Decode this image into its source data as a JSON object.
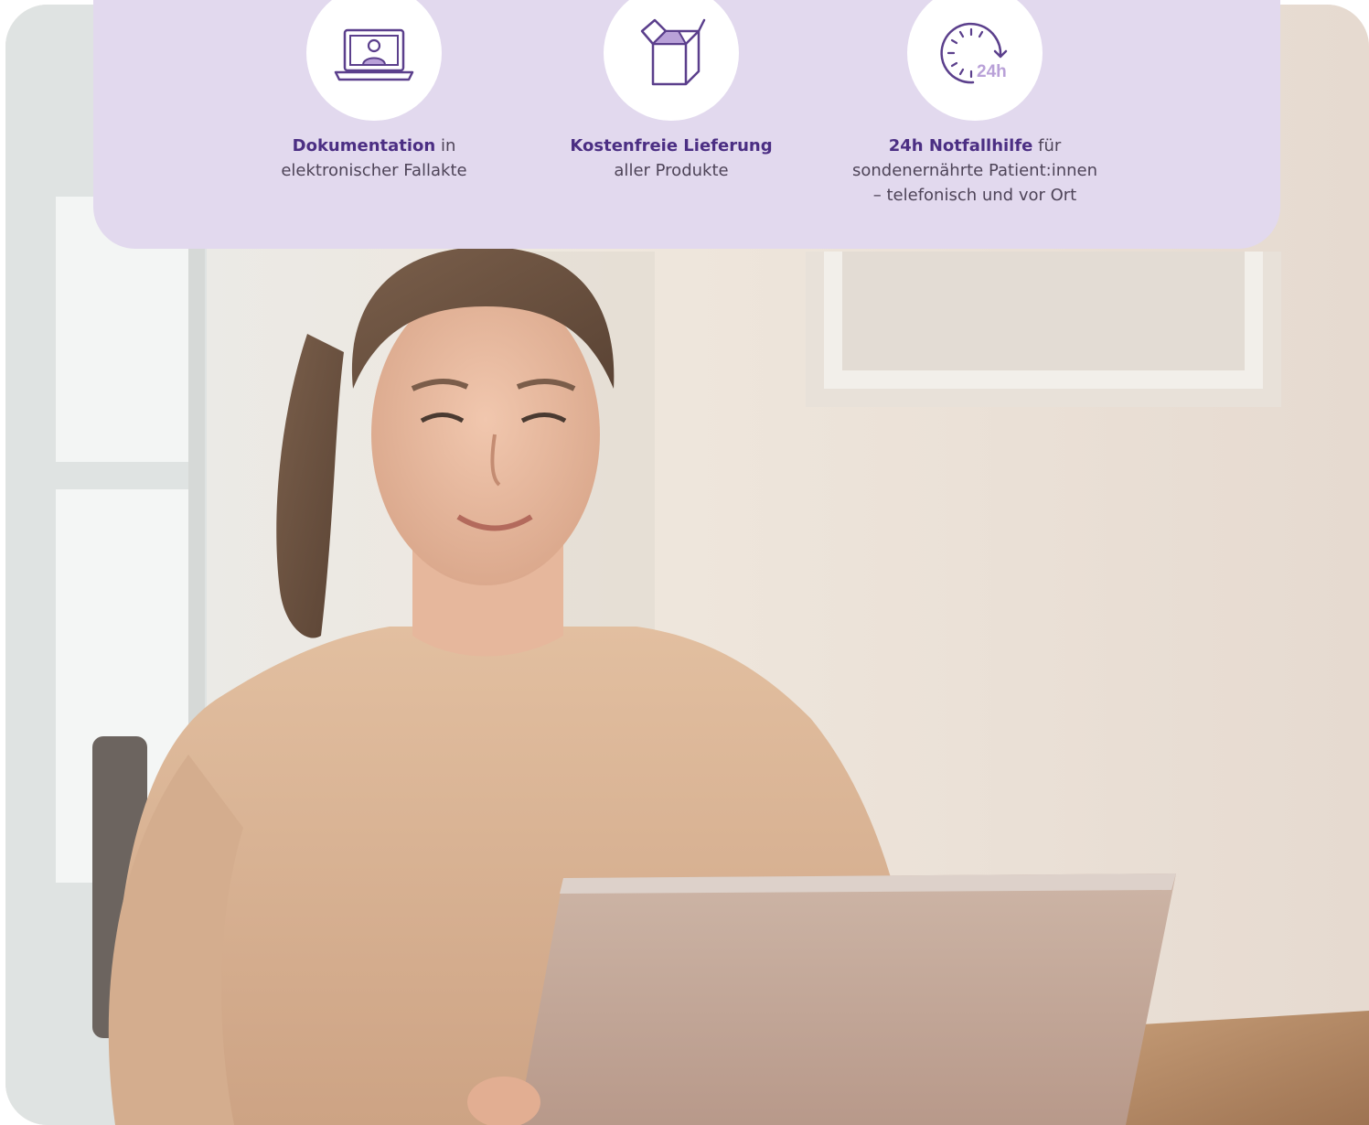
{
  "colors": {
    "panel_background": "#e2d9ee",
    "brand_purple": "#4b2e83",
    "icon_purple": "#5b3f8c",
    "icon_fill_light": "#b9a1d8",
    "text_gray": "#4e4458"
  },
  "features": [
    {
      "icon": "laptop-user-icon",
      "title": "Dokumentation",
      "line1_suffix": " in",
      "line2": "elektronischer Fallakte",
      "line3": ""
    },
    {
      "icon": "open-box-icon",
      "title": "Kostenfreie Lieferung",
      "line1_suffix": "",
      "line2": "aller Produkte",
      "line3": ""
    },
    {
      "icon": "clock-24h-icon",
      "icon_label": "24h",
      "title": "24h Notfallhilfe",
      "line1_suffix": " für",
      "line2": "sondenernährte Patient:innen",
      "line3": "– telefonisch und vor Ort"
    }
  ]
}
